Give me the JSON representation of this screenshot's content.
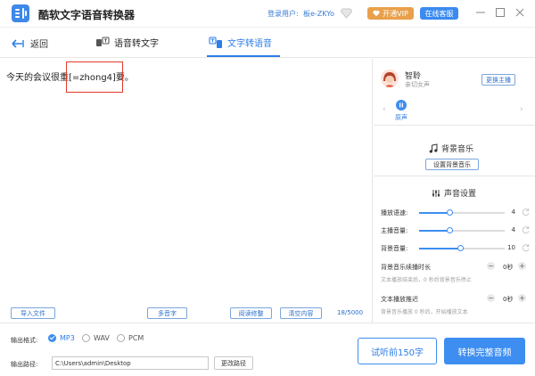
{
  "app": {
    "title": "酷软文字语音转换器"
  },
  "header": {
    "login_label": "登录用户:",
    "username": "板e-ZKYo",
    "vip_label": "开通VIP",
    "service_label": "在线客服"
  },
  "tabs": {
    "back_label": "返回",
    "speech_to_text": "语音转文字",
    "text_to_speech": "文字转语音",
    "active": "文字转语音"
  },
  "editor": {
    "text": "今天的会议很重[=zhong4]要。",
    "import_label": "导入文件",
    "polyphonic_label": "多音字",
    "read_correction_label": "阅读修整",
    "clear_label": "清空内容",
    "counter": "18/5000"
  },
  "voice": {
    "name": "智聆",
    "desc": "亲切女声",
    "change_label": "更换主播",
    "play_label": "原声"
  },
  "bgm": {
    "title": "背景音乐",
    "set_label": "设置背景音乐"
  },
  "sound": {
    "title": "声音设置",
    "rate": {
      "label": "播放语速:",
      "value": "4",
      "fraction": 0.36
    },
    "main_volume": {
      "label": "主播音量:",
      "value": "4",
      "fraction": 0.36
    },
    "bgm_volume": {
      "label": "背景音量:",
      "value": "10",
      "fraction": 0.48
    },
    "bgm_duration": {
      "label": "背景音乐续播时长",
      "value": "0秒",
      "hint": "文本播放结束后，0 秒后背景音乐停止"
    },
    "text_delay": {
      "label": "文本播放推迟",
      "value": "0秒",
      "hint": "背景音乐播放 0 秒后，开始播放文本"
    }
  },
  "output": {
    "format_label": "输出格式:",
    "formats": [
      "MP3",
      "WAV",
      "PCM"
    ],
    "selected_format": "MP3",
    "path_label": "输出路径:",
    "path_value": "C:\\Users\\admin\\Desktop",
    "change_path_label": "更改路径"
  },
  "actions": {
    "preview_label": "试听前150字",
    "convert_label": "转换完整音频"
  },
  "colors": {
    "accent": "#3d8ef0",
    "vip": "#e9a04b",
    "highlight_box": "#e23c2c"
  }
}
